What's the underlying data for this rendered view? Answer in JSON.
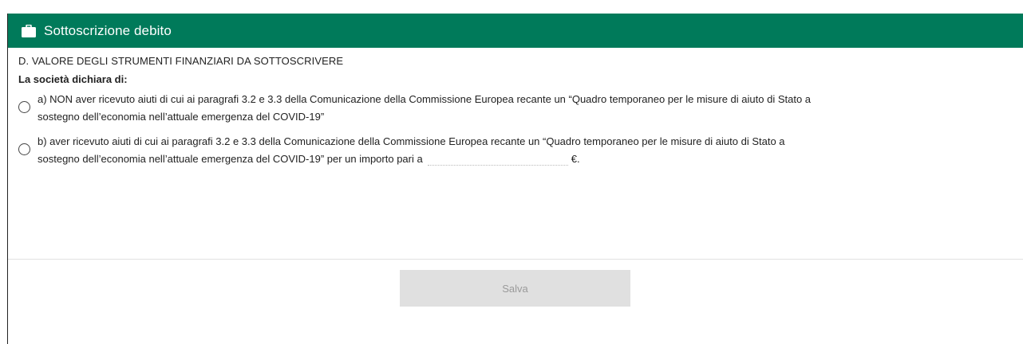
{
  "header": {
    "title": "Sottoscrizione debito",
    "icon": "briefcase-icon",
    "background_color": "#007a5a"
  },
  "form": {
    "section_title": "D. VALORE DEGLI STRUMENTI FINANZIARI DA SOTTOSCRIVERE",
    "declares_label": "La società dichiara di:",
    "options": [
      {
        "text_line1": "a) NON aver ricevuto aiuti di cui ai paragrafi 3.2 e 3.3 della Comunicazione della Commissione Europea recante un “Quadro temporaneo per le misure di aiuto di Stato a",
        "text_line2": "sostegno dell’economia nell’attuale emergenza del COVID-19”",
        "selected": false
      },
      {
        "text_line1": "b) aver ricevuto aiuti di cui ai paragrafi 3.2 e 3.3 della Comunicazione della Commissione Europea recante un “Quadro temporaneo per le misure di aiuto di Stato a",
        "text_line2": "sostegno dell’economia nell’attuale emergenza del COVID-19” per un importo pari a",
        "amount_value": "",
        "currency_suffix": "€.",
        "selected": false
      }
    ]
  },
  "footer": {
    "save_label": "Salva"
  }
}
